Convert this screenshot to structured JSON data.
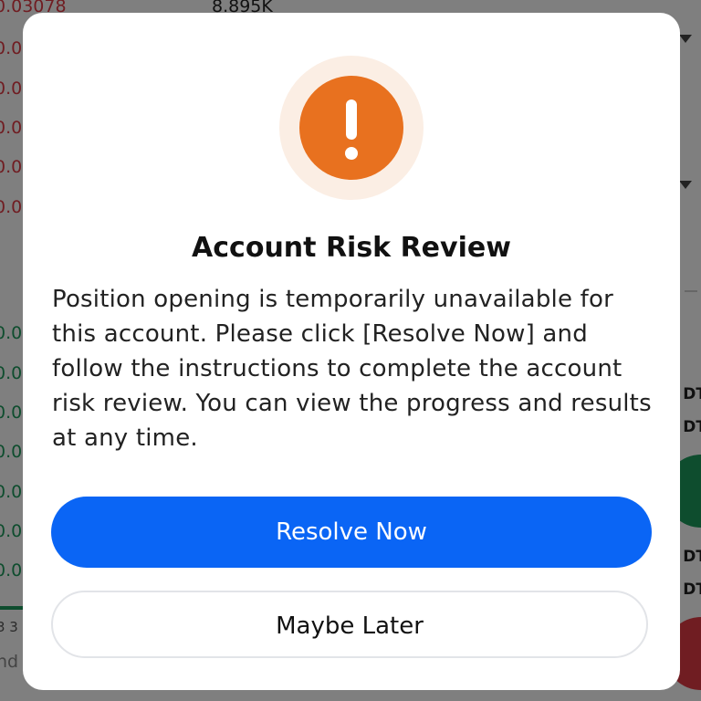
{
  "background": {
    "top_price": "0.03078",
    "top_volume": "8.895K",
    "left_prices_red": [
      "0.0",
      "0.0",
      "0.0",
      "0.0",
      "0.0"
    ],
    "left_prices_green": [
      "0.0",
      "0.0",
      "0.0",
      "0.0",
      "0.0",
      "0.0",
      "0.0"
    ],
    "bottom_text": "3 3",
    "bottom_text2": "nd",
    "right_labels": [
      "DT",
      "DT",
      "DT",
      "DT"
    ]
  },
  "dialog": {
    "icon": "exclamation-icon",
    "title": "Account Risk Review",
    "body": "Position opening is temporarily unavailable for this account. Please click [Resolve Now] and follow the instructions to complete the account risk review. You can view the progress and results at any time.",
    "primary_button": "Resolve Now",
    "secondary_button": "Maybe Later"
  },
  "colors": {
    "primary": "#0a65f5",
    "warning": "#e8711f",
    "warning_halo": "#fbeee4",
    "sell_red": "#e03a45",
    "buy_green": "#1d9a5c"
  }
}
